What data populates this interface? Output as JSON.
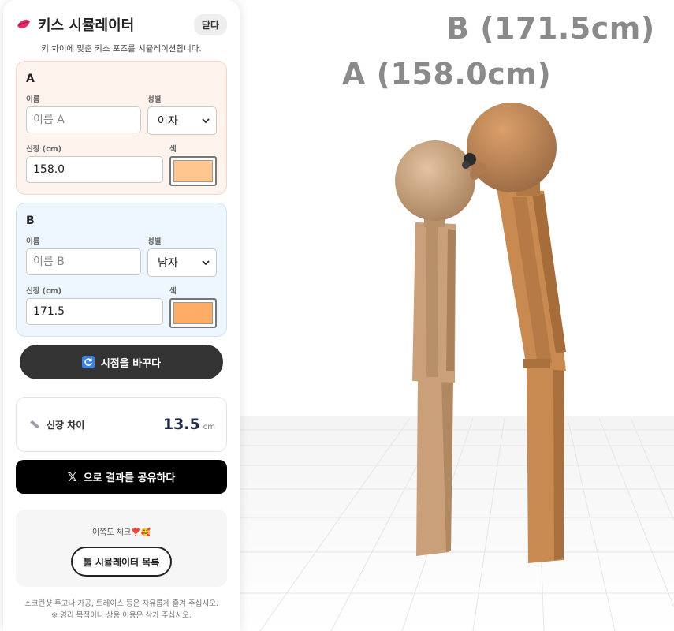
{
  "scene": {
    "label_a": "A (158.0cm)",
    "label_b": "B (171.5cm)"
  },
  "panel": {
    "title": "키스 시뮬레이터",
    "close_label": "닫다",
    "subtitle": "키 차이에 맞춘 키스 포즈를 시뮬레이션합니다."
  },
  "person_a": {
    "heading": "A",
    "name_label": "이름",
    "name_placeholder": "이름 A",
    "gender_label": "성별",
    "gender_value": "여자",
    "height_label": "신장 (cm)",
    "height_value": "158.0",
    "color_label": "색",
    "color": "#ffc68f"
  },
  "person_b": {
    "heading": "B",
    "name_label": "이름",
    "name_placeholder": "이름 B",
    "gender_label": "성별",
    "gender_value": "남자",
    "height_label": "신장 (cm)",
    "height_value": "171.5",
    "color_label": "색",
    "color": "#ffad66"
  },
  "view_button": "시점을 바꾸다",
  "difference": {
    "label": "신장 차이",
    "value": "13.5",
    "unit": "cm"
  },
  "share": {
    "icon_text": "𝕏",
    "label": "으로 결과를 공유하다"
  },
  "promo": {
    "text": "이쪽도 체크❣️🥰",
    "button": "툴 시뮬레이터 목록"
  },
  "footer": {
    "line1": "스크린샷 투고나 가공, 트레이스 등은 자유롭게 즐겨 주십시오.",
    "line2": "※ 영리 목적이나 상용 이용은 삼가 주십시오."
  },
  "colors": {
    "skin_a": "#c9a07a",
    "skin_b": "#c98a52",
    "panel_dark": "#333333"
  }
}
